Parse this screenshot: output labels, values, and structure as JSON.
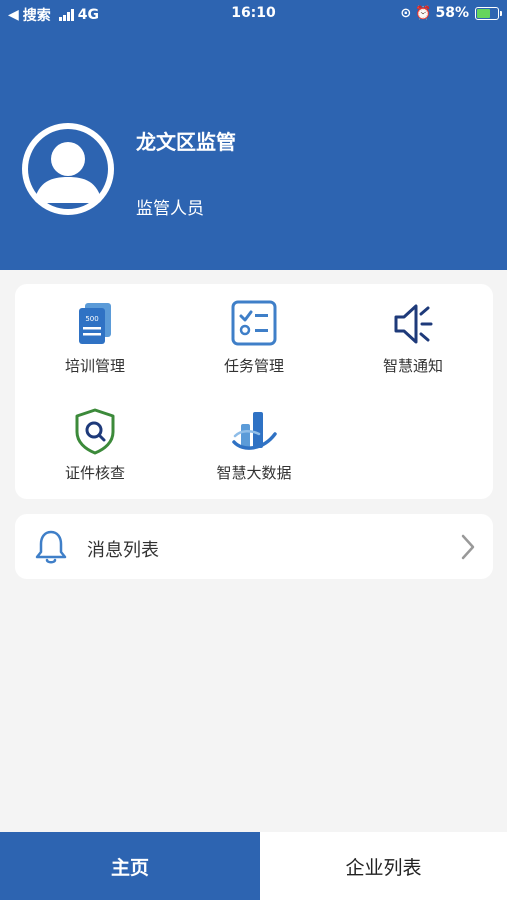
{
  "status": {
    "back_label": "搜索",
    "network": "4G",
    "time": "16:10",
    "battery": "58%",
    "battery_level": 0.58
  },
  "user": {
    "name": "龙文区监管",
    "role": "监管人员"
  },
  "menu": [
    {
      "label": "培训管理",
      "icon": "training-book-icon"
    },
    {
      "label": "任务管理",
      "icon": "task-checklist-icon"
    },
    {
      "label": "智慧通知",
      "icon": "speaker-icon"
    },
    {
      "label": "证件核查",
      "icon": "shield-search-icon"
    },
    {
      "label": "智慧大数据",
      "icon": "big-data-chart-icon"
    }
  ],
  "book_number": "500",
  "messages": {
    "label": "消息列表",
    "icon": "bell-icon"
  },
  "tabs": [
    {
      "label": "主页"
    },
    {
      "label": "企业列表"
    }
  ],
  "colors": {
    "primary": "#2d64b1",
    "green": "#3c8a3a",
    "navy": "#1e3a7a"
  }
}
